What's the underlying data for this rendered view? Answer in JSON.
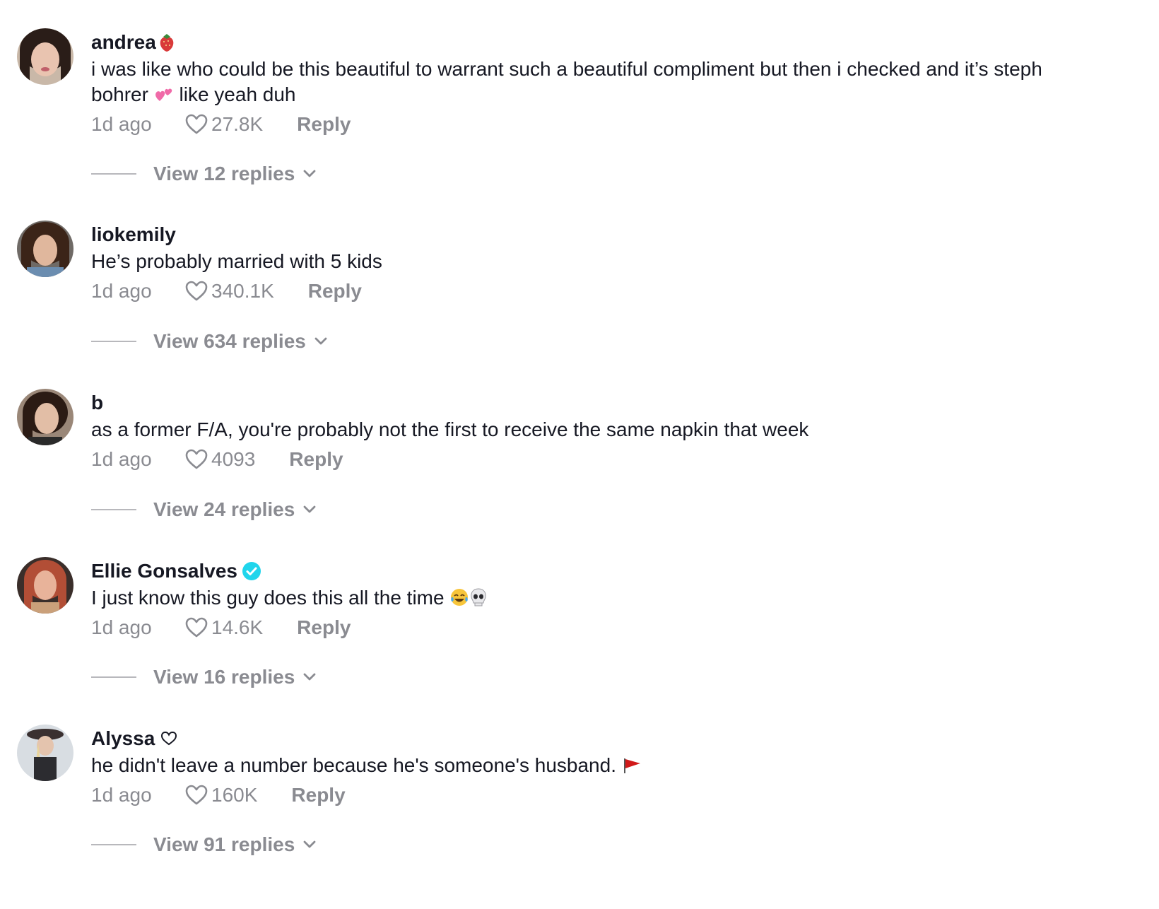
{
  "comments": [
    {
      "username": "andrea",
      "name_emoji": "strawberry",
      "text_line1": "i was like who could be this beautiful to warrant such a beautiful compliment but then i checked and it’s steph",
      "text_line2a": "bohrer",
      "text_emoji": "two-hearts",
      "text_line2b": "like yeah duh",
      "time": "1d ago",
      "likes": "27.8K",
      "reply": "Reply",
      "view_replies": "View 12 replies"
    },
    {
      "username": "liokemily",
      "text": "He’s probably married with 5 kids",
      "time": "1d ago",
      "likes": "340.1K",
      "reply": "Reply",
      "view_replies": "View 634 replies"
    },
    {
      "username": "b",
      "text": "as a former F/A, you're probably not the first to receive the same napkin that week",
      "time": "1d ago",
      "likes": "4093",
      "reply": "Reply",
      "view_replies": "View 24 replies"
    },
    {
      "username": "Ellie Gonsalves",
      "verified": true,
      "text": "I just know this guy does this all the time",
      "text_emojis": [
        "tears-of-joy",
        "skull"
      ],
      "time": "1d ago",
      "likes": "14.6K",
      "reply": "Reply",
      "view_replies": "View 16 replies"
    },
    {
      "username": "Alyssa",
      "name_emoji": "white-heart",
      "text": "he didn't leave a number because he's someone's husband.",
      "text_emojis": [
        "red-flag"
      ],
      "time": "1d ago",
      "likes": "160K",
      "reply": "Reply",
      "view_replies": "View 91 replies"
    }
  ],
  "colors": {
    "text": "#161823",
    "muted": "#8a8b91",
    "verified": "#20d5ec"
  }
}
